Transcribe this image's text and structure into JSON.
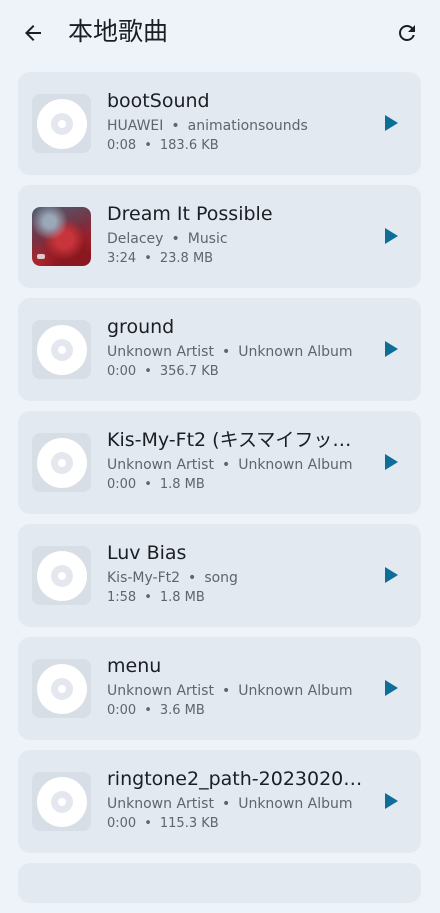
{
  "header": {
    "title": "本地歌曲",
    "back_icon": "arrow-left-icon",
    "refresh_icon": "refresh-icon"
  },
  "colors": {
    "accent": "#0d6e98",
    "background": "#eef3fa",
    "card": "#e3e9f1"
  },
  "songs": [
    {
      "title": "bootSound",
      "artist": "HUAWEI",
      "album": "animationsounds",
      "duration": "0:08",
      "size": "183.6 KB",
      "art": "default"
    },
    {
      "title": "Dream It Possible",
      "artist": "Delacey",
      "album": "Music",
      "duration": "3:24",
      "size": "23.8 MB",
      "art": "cover"
    },
    {
      "title": "ground",
      "artist": "Unknown Artist",
      "album": "Unknown Album",
      "duration": "0:00",
      "size": "356.7 KB",
      "art": "default"
    },
    {
      "title": "Kis-My-Ft2 (キスマイフッ…",
      "artist": "Unknown Artist",
      "album": "Unknown Album",
      "duration": "0:00",
      "size": "1.8 MB",
      "art": "default"
    },
    {
      "title": "Luv Bias",
      "artist": "Kis-My-Ft2",
      "album": "song",
      "duration": "1:58",
      "size": "1.8 MB",
      "art": "default"
    },
    {
      "title": "menu",
      "artist": "Unknown Artist",
      "album": "Unknown Album",
      "duration": "0:00",
      "size": "3.6 MB",
      "art": "default"
    },
    {
      "title": "ringtone2_path-2023020…",
      "artist": "Unknown Artist",
      "album": "Unknown Album",
      "duration": "0:00",
      "size": "115.3 KB",
      "art": "default"
    }
  ],
  "separator": "•"
}
